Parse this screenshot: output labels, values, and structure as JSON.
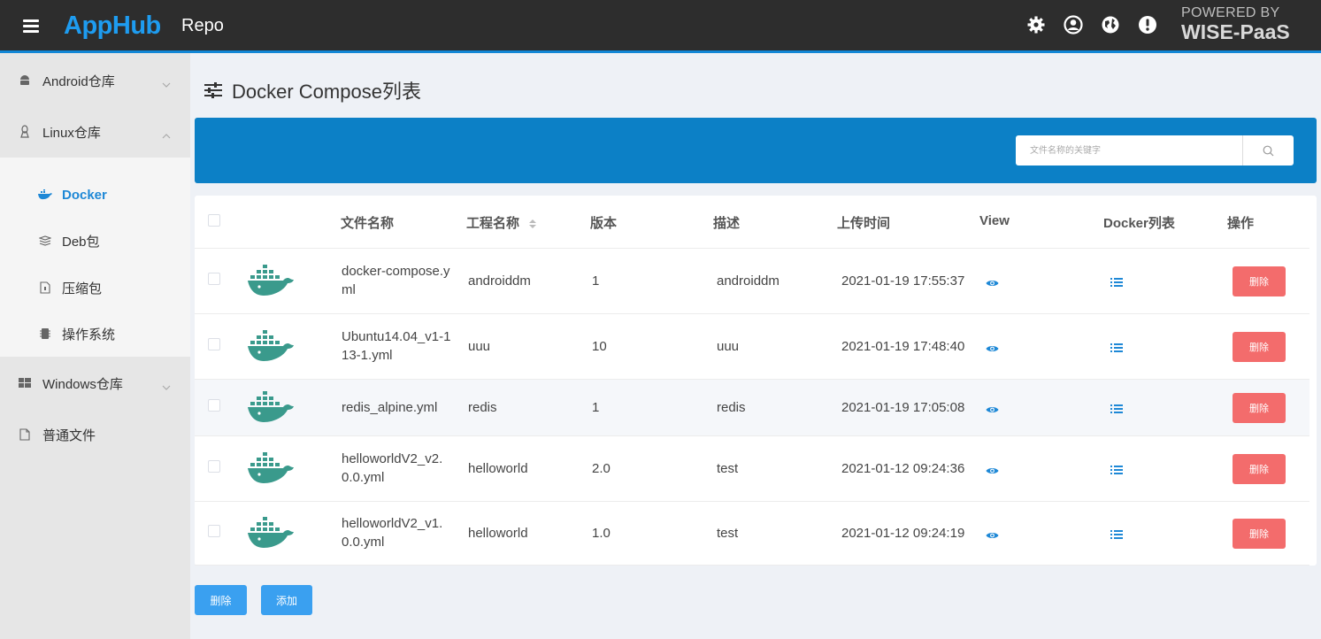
{
  "header": {
    "logo": "AppHub",
    "section": "Repo",
    "powered_line1": "POWERED BY",
    "powered_line2": "WISE-PaaS",
    "icons": [
      "gear-icon",
      "user-icon",
      "globe-icon",
      "alert-icon"
    ]
  },
  "sidebar": {
    "items": [
      {
        "label": "Android仓库",
        "icon": "android-icon"
      },
      {
        "label": "Linux仓库",
        "icon": "linux-icon"
      },
      {
        "label": "Windows仓库",
        "icon": "windows-icon"
      },
      {
        "label": "普通文件",
        "icon": "file-icon"
      }
    ],
    "subitems": [
      {
        "label": "Docker",
        "icon": "docker-icon",
        "active": true
      },
      {
        "label": "Deb包",
        "icon": "box-icon"
      },
      {
        "label": "压缩包",
        "icon": "archive-icon"
      },
      {
        "label": "操作系统",
        "icon": "chip-icon"
      }
    ]
  },
  "page": {
    "title": "Docker Compose列表"
  },
  "search": {
    "placeholder": "文件名称的关键字"
  },
  "table": {
    "columns": [
      "文件名称",
      "工程名称",
      "版本",
      "描述",
      "上传时间",
      "View",
      "Docker列表",
      "操作"
    ],
    "rows": [
      {
        "file_line1": "docker-compose.y",
        "file_line2": "ml",
        "project": "androiddm",
        "version": "1",
        "desc": "androiddm",
        "time": "2021-01-19 17:55:37",
        "action": "删除"
      },
      {
        "file_line1": "Ubuntu14.04_v1-1",
        "file_line2": "13-1.yml",
        "project": "uuu",
        "version": "10",
        "desc": "uuu",
        "time": "2021-01-19 17:48:40",
        "action": "删除"
      },
      {
        "file_line1": "redis_alpine.yml",
        "file_line2": "",
        "project": "redis",
        "version": "1",
        "desc": "redis",
        "time": "2021-01-19 17:05:08",
        "action": "删除"
      },
      {
        "file_line1": "helloworldV2_v2.",
        "file_line2": "0.0.yml",
        "project": "helloworld",
        "version": "2.0",
        "desc": "test",
        "time": "2021-01-12 09:24:36",
        "action": "删除"
      },
      {
        "file_line1": "helloworldV2_v1.",
        "file_line2": "0.0.yml",
        "project": "helloworld",
        "version": "1.0",
        "desc": "test",
        "time": "2021-01-12 09:24:19",
        "action": "删除"
      }
    ]
  },
  "footer": {
    "delete_label": "删除",
    "add_label": "添加"
  },
  "colors": {
    "accent": "#0c80c6",
    "danger": "#f36c6c",
    "docker_whale": "#3a9a8c"
  }
}
